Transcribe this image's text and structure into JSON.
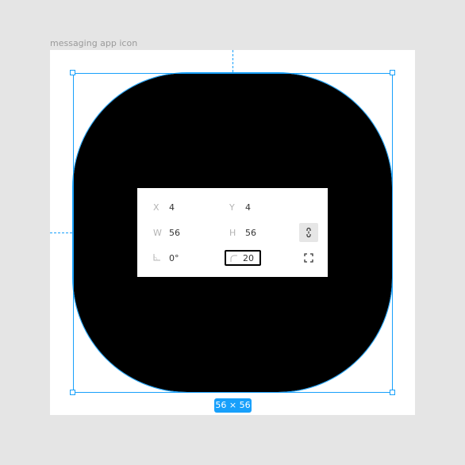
{
  "frame": {
    "label": "messaging app icon"
  },
  "selection": {
    "size_label": "56 × 56"
  },
  "properties": {
    "x": {
      "label": "X",
      "value": "4"
    },
    "y": {
      "label": "Y",
      "value": "4"
    },
    "w": {
      "label": "W",
      "value": "56"
    },
    "h": {
      "label": "H",
      "value": "56"
    },
    "rotation": {
      "value": "0°"
    },
    "corner_radius": {
      "value": "20"
    },
    "constrain_proportions_icon": "link-icon",
    "independent_corners_icon": "corners-icon",
    "rotation_icon": "angle-icon"
  },
  "colors": {
    "accent": "#18a0fb",
    "shape_fill": "#000000"
  }
}
